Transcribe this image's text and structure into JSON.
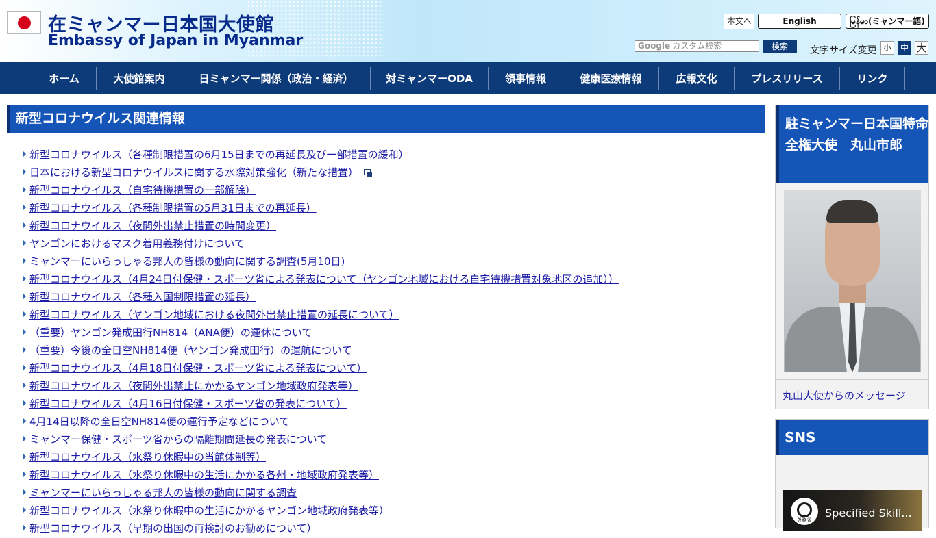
{
  "header": {
    "title_ja": "在ミャンマー日本国大使館",
    "title_en": "Embassy of Japan in Myanmar",
    "skip_link": "本文へ",
    "lang_en": "English",
    "lang_mm": "မြန်မာ(ミャンマー語)",
    "search": {
      "google": "Google",
      "placeholder": "カスタム検索",
      "button": "検索"
    },
    "font_size": {
      "label": "文字サイズ変更",
      "small": "小",
      "medium": "中",
      "large": "大"
    }
  },
  "nav": [
    "ホーム",
    "大使館案内",
    "日ミャンマー関係（政治・経済）",
    "対ミャンマーODA",
    "領事情報",
    "健康医療情報",
    "広報文化",
    "プレスリリース",
    "リンク"
  ],
  "main": {
    "heading": "新型コロナウイルス関連情報",
    "items": [
      "新型コロナウイルス（各種制限措置の6月15日までの再延長及び一部措置の緩和）",
      "日本における新型コロナウイルスに関する水際対策強化（新たな措置）",
      "新型コロナウイルス（自宅待機措置の一部解除）",
      "新型コロナウイルス（各種制限措置の5月31日までの再延長）",
      "新型コロナウイルス（夜間外出禁止措置の時間変更）",
      "ヤンゴンにおけるマスク着用義務付けについて",
      "ミャンマーにいらっしゃる邦人の皆様の動向に関する調査(5月10日)",
      "新型コロナウイルス（4月24日付保健・スポーツ省による発表について（ヤンゴン地域における自宅待機措置対象地区の追加））",
      "新型コロナウイルス（各種入国制限措置の延長）",
      "新型コロナウイルス（ヤンゴン地域における夜間外出禁止措置の延長について）",
      "（重要）ヤンゴン発成田行NH814（ANA便）の運休について",
      "（重要）今後の全日空NH814便（ヤンゴン発成田行）の運航について",
      "新型コロナウイルス（4月18日付保健・スポーツ省による発表について）",
      "新型コロナウイルス（夜間外出禁止にかかるヤンゴン地域政府発表等）",
      "新型コロナウイルス（4月16日付保健・スポーツ省の発表について）",
      "4月14日以降の全日空NH814便の運行予定などについて",
      "ミャンマー保健・スポーツ省からの隔離期間延長の発表について",
      "新型コロナウイルス（水祭り休暇中の当館体制等）",
      "新型コロナウイルス（水祭り休暇中の生活にかかる各州・地域政府発表等）",
      "ミャンマーにいらっしゃる邦人の皆様の動向に関する調査",
      "新型コロナウイルス（水祭り休暇中の生活にかかるヤンゴン地域政府発表等）",
      "新型コロナウイルス（早期の出国の再検討のお勧めについて）"
    ]
  },
  "sidebar": {
    "ambassador_heading": "駐ミャンマー日本国特命全権大使　丸山市郎",
    "ambassador_link": "丸山大使からのメッセージ",
    "sns_heading": "SNS",
    "video_title": "Specified Skill...",
    "video_logo_text": "外務省"
  }
}
